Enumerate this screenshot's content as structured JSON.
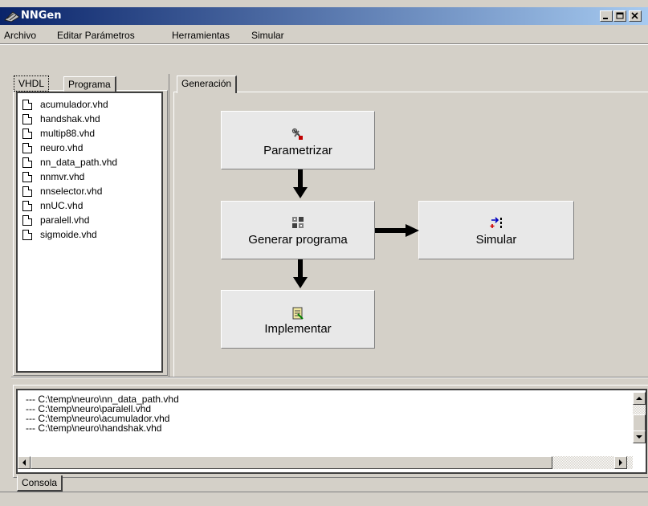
{
  "window": {
    "title": "NNGen"
  },
  "menu": {
    "items": [
      "Archivo",
      "Editar Parámetros",
      "Herramientas",
      "Simular"
    ]
  },
  "left_panel": {
    "tabs": [
      "VHDL",
      "Programa"
    ],
    "files": [
      "acumulador.vhd",
      "handshak.vhd",
      "multip88.vhd",
      "neuro.vhd",
      "nn_data_path.vhd",
      "nnmvr.vhd",
      "nnselector.vhd",
      "nnUC.vhd",
      "paralell.vhd",
      "sigmoide.vhd"
    ]
  },
  "main_panel": {
    "tab": "Generación",
    "buttons": {
      "parametrizar": "Parametrizar",
      "generar": "Generar programa",
      "simular": "Simular",
      "implementar": "Implementar"
    }
  },
  "console": {
    "tab": "Consola",
    "lines": [
      "---   C:\\temp\\neuro\\nn_data_path.vhd",
      "---   C:\\temp\\neuro\\paralell.vhd",
      "---   C:\\temp\\neuro\\acumulador.vhd",
      "---   C:\\temp\\neuro\\handshak.vhd"
    ]
  },
  "colors": {
    "titlebar_start": "#0a246a",
    "titlebar_end": "#a6caf0",
    "face": "#d4d0c8"
  }
}
